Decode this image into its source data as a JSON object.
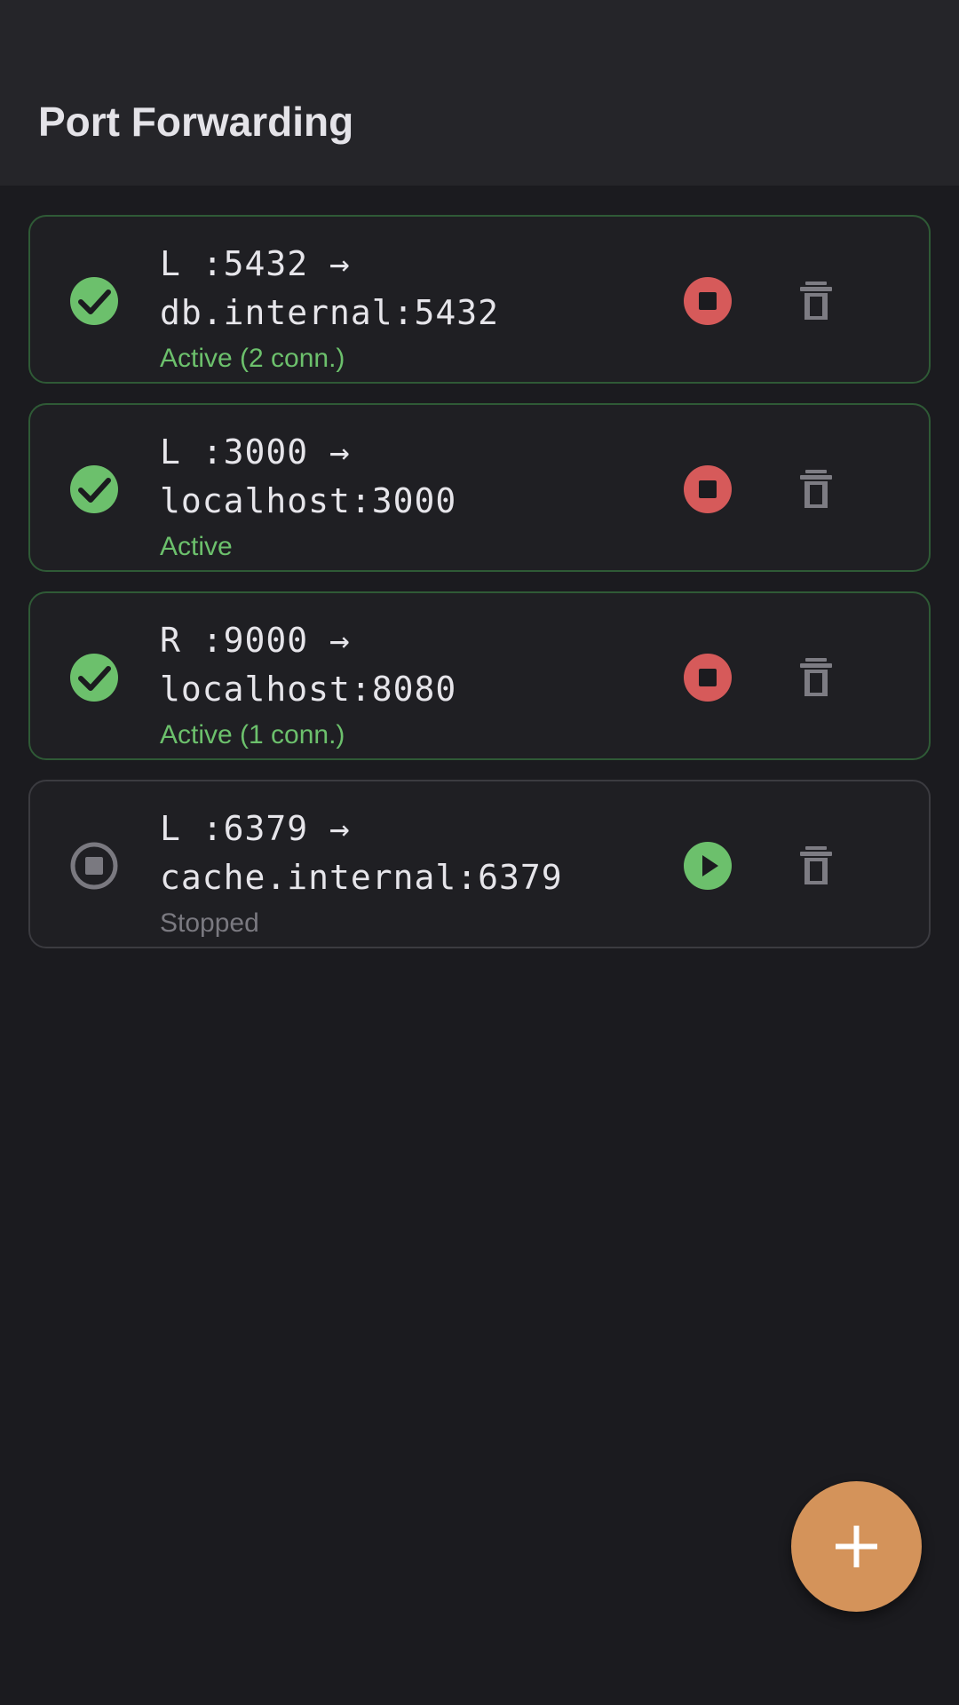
{
  "app_bar": {
    "title": "Port Forwarding"
  },
  "colors": {
    "active": "#6cc06c",
    "stopped": "#7a7980",
    "stop_button": "#d65a5a",
    "start_button": "#6cc06c",
    "delete_icon": "#7d7c83",
    "fab": "#d4935a"
  },
  "rules": [
    {
      "direction_line": "L :5432 →",
      "target_line": "db.internal:5432",
      "status_text": "Active (2 conn.)",
      "state": "active",
      "status_icon": "check-circle-icon",
      "toggle_icon": "stop-icon"
    },
    {
      "direction_line": "L :3000 →",
      "target_line": "localhost:3000",
      "status_text": "Active",
      "state": "active",
      "status_icon": "check-circle-icon",
      "toggle_icon": "stop-icon"
    },
    {
      "direction_line": "R :9000 →",
      "target_line": "localhost:8080",
      "status_text": "Active (1 conn.)",
      "state": "active",
      "status_icon": "check-circle-icon",
      "toggle_icon": "stop-icon"
    },
    {
      "direction_line": "L :6379 →",
      "target_line": "cache.internal:6379",
      "status_text": "Stopped",
      "state": "stopped",
      "status_icon": "stopped-circle-icon",
      "toggle_icon": "play-icon"
    }
  ],
  "fab": {
    "icon": "plus-icon"
  }
}
